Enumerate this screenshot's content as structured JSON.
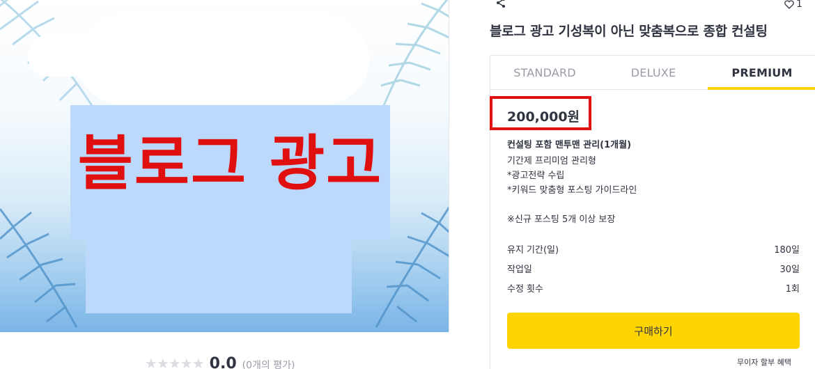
{
  "hero": {
    "text": "블로그 광고"
  },
  "rating": {
    "stars": "★★★★★",
    "score": "0.0",
    "count": "(0개의 평가)"
  },
  "header": {
    "like_count": "1",
    "share_icon": "share-icon",
    "like_icon": "heart-icon"
  },
  "title": "블로그 광고 기성복이 아닌 맞춤복으로 종합 컨설팅",
  "tabs": [
    {
      "label": "STANDARD",
      "active": false
    },
    {
      "label": "DELUXE",
      "active": false
    },
    {
      "label": "PREMIUM",
      "active": true
    }
  ],
  "package": {
    "price": "200,000원",
    "name": "컨설팅 포함 맨투맨 관리(1개월)",
    "description": "기간제 프리미엄 관리형\n*광고전략 수립\n*키워드 맞춤형 포스팅 가이드라인\n\n※신규 포스팅 5개 이상 보장"
  },
  "specs": [
    {
      "label": "유지 기간(일)",
      "value": "180일"
    },
    {
      "label": "작업일",
      "value": "30일"
    },
    {
      "label": "수정 횟수",
      "value": "1회"
    }
  ],
  "buy_label": "구매하기",
  "installment_label": "무이자 할부 혜택",
  "colors": {
    "accent": "#ffd400",
    "highlight": "#e01010",
    "overlay": "#bcd8fb"
  }
}
